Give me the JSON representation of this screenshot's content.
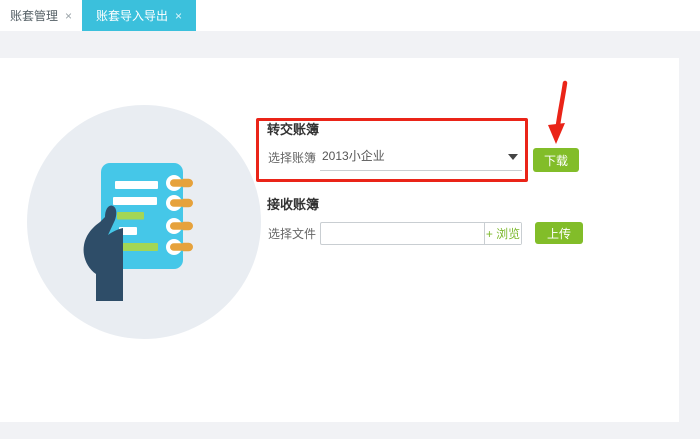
{
  "tabs": [
    {
      "label": "账套管理",
      "close": "×",
      "active": false
    },
    {
      "label": "账套导入导出",
      "close": "×",
      "active": true
    }
  ],
  "transfer_section": {
    "title": "转交账簿",
    "select_label": "选择账簿",
    "selected_value": "2013小企业",
    "download_label": "下载"
  },
  "receive_section": {
    "title": "接收账簿",
    "file_label": "选择文件",
    "file_value": "",
    "browse_label": "+ 浏览",
    "upload_label": "上传"
  },
  "icons": {
    "tab_close": "close-icon",
    "dropdown_caret": "chevron-down-icon",
    "annotation_arrow": "arrow-down-icon",
    "illustration": "notebook-in-hand-illustration"
  },
  "colors": {
    "active_tab_cyan": "#3bc0dc",
    "button_green": "#82bd29",
    "browse_text_green": "#7cb82c",
    "annotation_red": "#ea2418",
    "page_background": "#f1f2f5",
    "panel_background": "#ffffff",
    "circle_background": "#e9edf2",
    "notebook_cyan": "#45c7e8",
    "hand_navy": "#2e4d68",
    "ring_orange": "#e6a23c",
    "notebook_line_green": "#a3d655"
  }
}
